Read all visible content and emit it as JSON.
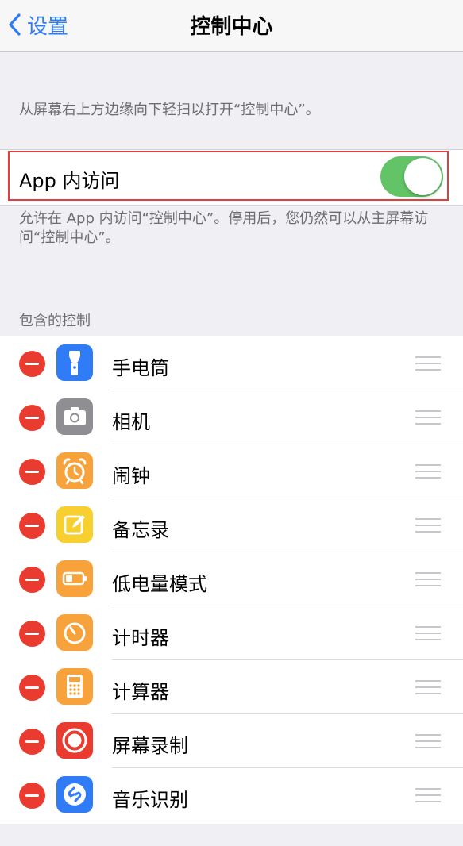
{
  "nav": {
    "back_label": "设置",
    "title": "控制中心"
  },
  "description_top": "从屏幕右上方边缘向下轻扫以打开“控制中心”。",
  "app_access": {
    "label": "App 内访问",
    "toggle_on": true
  },
  "description_access": "允许在 App 内访问“控制中心”。停用后，您仍然可以从主屏幕访问“控制中心”。",
  "section_header": "包含的控制",
  "controls": [
    {
      "label": "手电筒",
      "icon": "flashlight-icon",
      "color": "#2f7cf6"
    },
    {
      "label": "相机",
      "icon": "camera-icon",
      "color": "#8e8e93"
    },
    {
      "label": "闹钟",
      "icon": "alarm-icon",
      "color": "#f7a23a"
    },
    {
      "label": "备忘录",
      "icon": "notes-icon",
      "color": "#f7cf2f"
    },
    {
      "label": "低电量模式",
      "icon": "battery-icon",
      "color": "#f7a23a"
    },
    {
      "label": "计时器",
      "icon": "timer-icon",
      "color": "#f7a23a"
    },
    {
      "label": "计算器",
      "icon": "calculator-icon",
      "color": "#f7a23a"
    },
    {
      "label": "屏幕录制",
      "icon": "screen-record-icon",
      "color": "#ea3b30"
    },
    {
      "label": "音乐识别",
      "icon": "music-recognition-icon",
      "color": "#2f7cf6"
    }
  ],
  "colors": {
    "accent": "#2f7cf6",
    "toggle_on": "#62c466",
    "delete": "#ea3b30",
    "highlight": "#e23c3c"
  }
}
